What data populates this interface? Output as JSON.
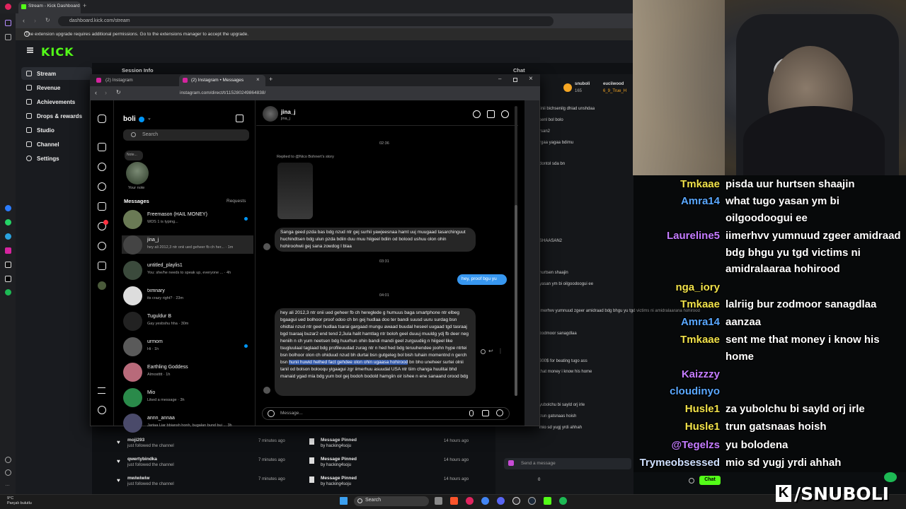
{
  "browser": {
    "tab_title": "Stream - Kick Dashboard",
    "url": "dashboard.kick.com/stream",
    "ext_notice": "The extension upgrade requires additional permissions. Go to the extensions manager to accept the upgrade."
  },
  "kick": {
    "logo": "KICK",
    "nav": [
      "Stream",
      "Revenue",
      "Achievements",
      "Drops & rewards",
      "Studio",
      "Channel",
      "Settings"
    ],
    "session_info": "Session Info",
    "chat_title": "Chat"
  },
  "ig_window": {
    "tab1": "(2) Instagram",
    "tab2": "(2) Instagram • Messages",
    "url": "instagram.com/direct/t/115280249864838/"
  },
  "ig": {
    "username": "boli",
    "search_placeholder": "Search",
    "note_text": "Note...",
    "note_label": "Your note",
    "messages_label": "Messages",
    "requests_label": "Requests",
    "conversations": [
      {
        "name": "Freemason (HAIL MONEY)",
        "snippet": "WDS 1 is typing...",
        "color": "#6a7a55"
      },
      {
        "name": "jina_j",
        "snippet": "hey ali 2012,3 ntr onii ued geheer fb ch her... · 1m",
        "color": "#444"
      },
      {
        "name": "untitled_playlis1",
        "snippet": "You: she/he needs to speak up, everyone ... · 4h",
        "color": "#3b4a3c"
      },
      {
        "name": "txmnary",
        "snippet": "its crazy right? · 23m",
        "color": "#ddd"
      },
      {
        "name": "Tuguldur B",
        "snippet": "Gay yesbshu hha · 30m",
        "color": "#222"
      },
      {
        "name": "urmom",
        "snippet": "Hi · 1h",
        "color": "#5a5a5a"
      },
      {
        "name": "Earthling Goddess",
        "snippet": "Almostttt · 1h",
        "color": "#b86a7a"
      },
      {
        "name": "Mio",
        "snippet": "Liked a message · 3h",
        "color": "#2a8a4a"
      },
      {
        "name": "annn_annaa",
        "snippet": "Jartaa Liar bbiansh honh, bugalan bund bui ... 3h",
        "color": "#4a4a6a"
      }
    ],
    "chat_name": "jina_j",
    "chat_handle": "jina_j",
    "time1": "02:36",
    "reply_note": "Replied to @Nico Bohnert's story",
    "msg1": "Sanga geed pzda bas bdg nzud ntr gej surhii yawjeesnaa hamt uuj muugaad tasarchinguut huchindtsen bdg ulun pzda bdiin duu muu hiigeel bdiin od bolood ushuu olon ohin hohiroohwii gej sana zowdog l blaa",
    "time2": "03:31",
    "msg2": "hey, proof bgu yu",
    "time3": "04:01",
    "msg3_a": "hey ali 2012,3 ntr onii ued geheer fb ch hereglede g humuus baga smartphone ntr elbeg bgaagui ued bolhoor proof odoo ch bn gej hudlaa doo ter bandi suusd uuru surdag bsn ohidtai nzud ntr geel hudlaa tsarai gargaad mungu awaad buudal heseel uugaad tgd tasraaj bgd tsaraaj buzar2 end tend 2,3ula halit hamtlag ntr boloh geel duuuj muuldg ydj fb deer neg heniih n ch yum neetsen bdg huurhun ohin bandi mandi geel zurguudiig n hiigeel like tsugluulaal taglaad bdg profileuudad zurag ntr n hed hed bdg teruuhendee joohn hype ntrtei bsn bolhoor olon ch ohiduud nzud bh durtai bsn gutgeleg bol bish tuhain momentnd n gerch bsn",
    "msg3_hl": "hunii huwid helhed fact gehdee olon ohin ugaasa hohirood",
    "msg3_b": "bn bho uneheer surtei olnii tanil od bolson bolooqu yigaagui zgr iimerhuu asuudal USA ntr tiim changa huulitai bhd manaid ygad mia bdg yum bol gej bodoh bodold hamgiin oir ishee n ene sanaand orood bdg",
    "compose_placeholder": "Message..."
  },
  "activity": [
    {
      "user": "moji293",
      "action": "just followed the channel",
      "time": "7 minutes ago"
    },
    {
      "user": "qwertybindka",
      "action": "just followed the channel",
      "time": "7 minutes ago"
    },
    {
      "user": "mwiwiwiw",
      "action": "just followed the channel",
      "time": "7 minutes ago"
    }
  ],
  "pinned": [
    {
      "title": "Message Pinned",
      "by": "by hacking4soju",
      "time": "14 hours ago"
    },
    {
      "title": "Message Pinned",
      "by": "by hacking4soju",
      "time": "14 hours ago"
    },
    {
      "title": "Message Pinned",
      "by": "by hacking4soju",
      "time": "14 hours ago"
    }
  ],
  "kick_chat": {
    "top_user": "snuboli",
    "top_user_count": "165",
    "top_user2": "euciiwood",
    "top_user2b": "6_9_True_H",
    "lines": [
      "iinii bichsenilg dhiad unshdaa",
      "senl bol bolo",
      "rsan2",
      "rgaa yagaa bdimu",
      "dontol sda bn",
      "SHAASAN2",
      "hurtsen shaajin",
      "yasan ym bi oilgoodoogui ee",
      "imerhvv yumnuud zgeer amidraad bdg bhgu yu tgd victims ni amidralaarana hohirood",
      "zodmoor sanagdlaa",
      "300$ for beating tugo ass",
      "that money i know his home",
      "yubolchu bi sayld orj irle",
      "trun gatsnaas hoish",
      "mio sd yugj yrdi ahhah"
    ],
    "send_placeholder": "Send a message",
    "chat_button": "Chat",
    "count": "0"
  },
  "overlay_chat": [
    {
      "user": "Tmkaae",
      "msg": "pisda uur hurtsen shaajin",
      "color": "#f0e14a"
    },
    {
      "user": "Amra14",
      "msg": "what tugo yasan ym bi",
      "color": "#5aa8ff"
    },
    {
      "user": "",
      "msg": "oilgoodoogui ee",
      "color": "#fff"
    },
    {
      "user": "Laureline5",
      "msg": "iimerhvv yumnuud zgeer amidraad",
      "color": "#c47cff"
    },
    {
      "user": "",
      "msg": "bdg bhgu yu tgd victims ni",
      "color": "#fff"
    },
    {
      "user": "",
      "msg": "amidralaaraa hohirood",
      "color": "#fff"
    },
    {
      "user": "nga_iory",
      "msg": "",
      "color": "#f0e14a"
    },
    {
      "user": "Tmkaae",
      "msg": "lalriig bur zodmoor sanagdlaa",
      "color": "#f0e14a"
    },
    {
      "user": "Amra14",
      "msg": "aanzaa",
      "color": "#5aa8ff"
    },
    {
      "user": "Tmkaae",
      "msg": "sent me that money i know his",
      "color": "#f0e14a"
    },
    {
      "user": "",
      "msg": "home",
      "color": "#fff"
    },
    {
      "user": "Kaizzzy",
      "msg": "",
      "color": "#c47cff"
    },
    {
      "user": "cloudinyo",
      "msg": "",
      "color": "#5aa8ff"
    },
    {
      "user": "Husle1",
      "msg": "za yubolchu bi sayld orj irle",
      "color": "#f0e14a"
    },
    {
      "user": "Husle1",
      "msg": "trun gatsnaas hoish",
      "color": "#f0e14a"
    },
    {
      "user": "@Tegelzs",
      "msg": "yu bolodena",
      "color": "#c47cff"
    },
    {
      "user": "Trymeobsessed",
      "msg": "mio sd yugj yrdi ahhah",
      "color": "#cfe0ff"
    }
  ],
  "brand": "/SNUBOLI",
  "brand_k": "K",
  "taskbar": {
    "search": "Search",
    "weather_temp": "9°C",
    "weather_desc": "Parçalı bulutlu"
  }
}
